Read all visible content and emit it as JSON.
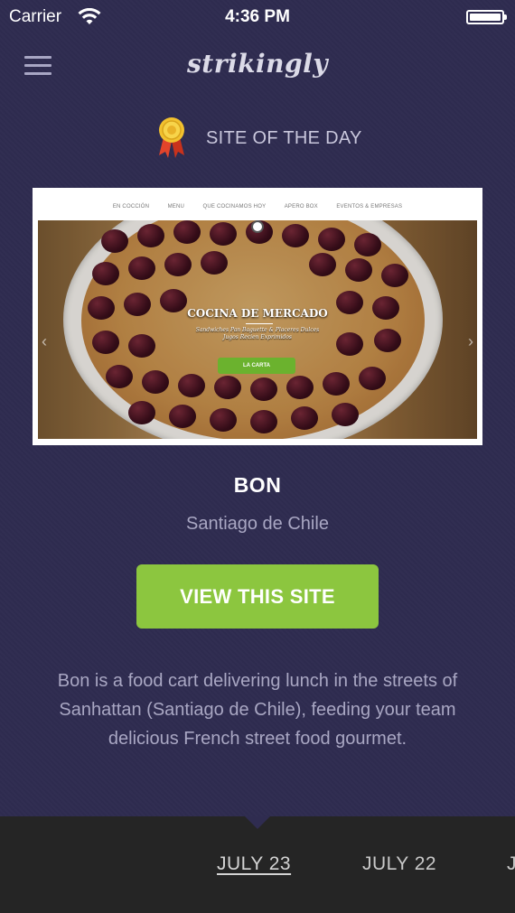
{
  "status_bar": {
    "carrier": "Carrier",
    "time": "4:36 PM"
  },
  "header": {
    "logo_text": "strikingly"
  },
  "site_of_the_day": {
    "label": "SITE OF THE DAY",
    "icon": "award-ribbon-icon"
  },
  "preview": {
    "nav_items": [
      "EN COCCIÓN",
      "MENU",
      "QUE COCINAMOS HOY",
      "APERO BOX",
      "EVENTOS & EMPRESAS"
    ],
    "hero_title": "COCINA DE MERCADO",
    "hero_subtitle_line1": "Sandwiches Pan Baguette & Placeres Dulces",
    "hero_subtitle_line2": "Jugos Recien Exprimidos",
    "hero_button": "LA CARTA"
  },
  "site": {
    "name": "BON",
    "location": "Santiago de Chile",
    "cta": "VIEW THIS SITE",
    "description": "Bon is a food cart delivering lunch in the streets of Sanhattan (Santiago de Chile), feeding your team delicious French street food gourmet."
  },
  "dates": [
    {
      "label": "JULY 23",
      "active": true
    },
    {
      "label": "JULY 22",
      "active": false
    },
    {
      "label": "J",
      "active": false
    }
  ],
  "colors": {
    "background": "#2f2c50",
    "cta_green": "#8cc63f",
    "muted_text": "#a9a7c3",
    "date_bar": "#252525"
  }
}
